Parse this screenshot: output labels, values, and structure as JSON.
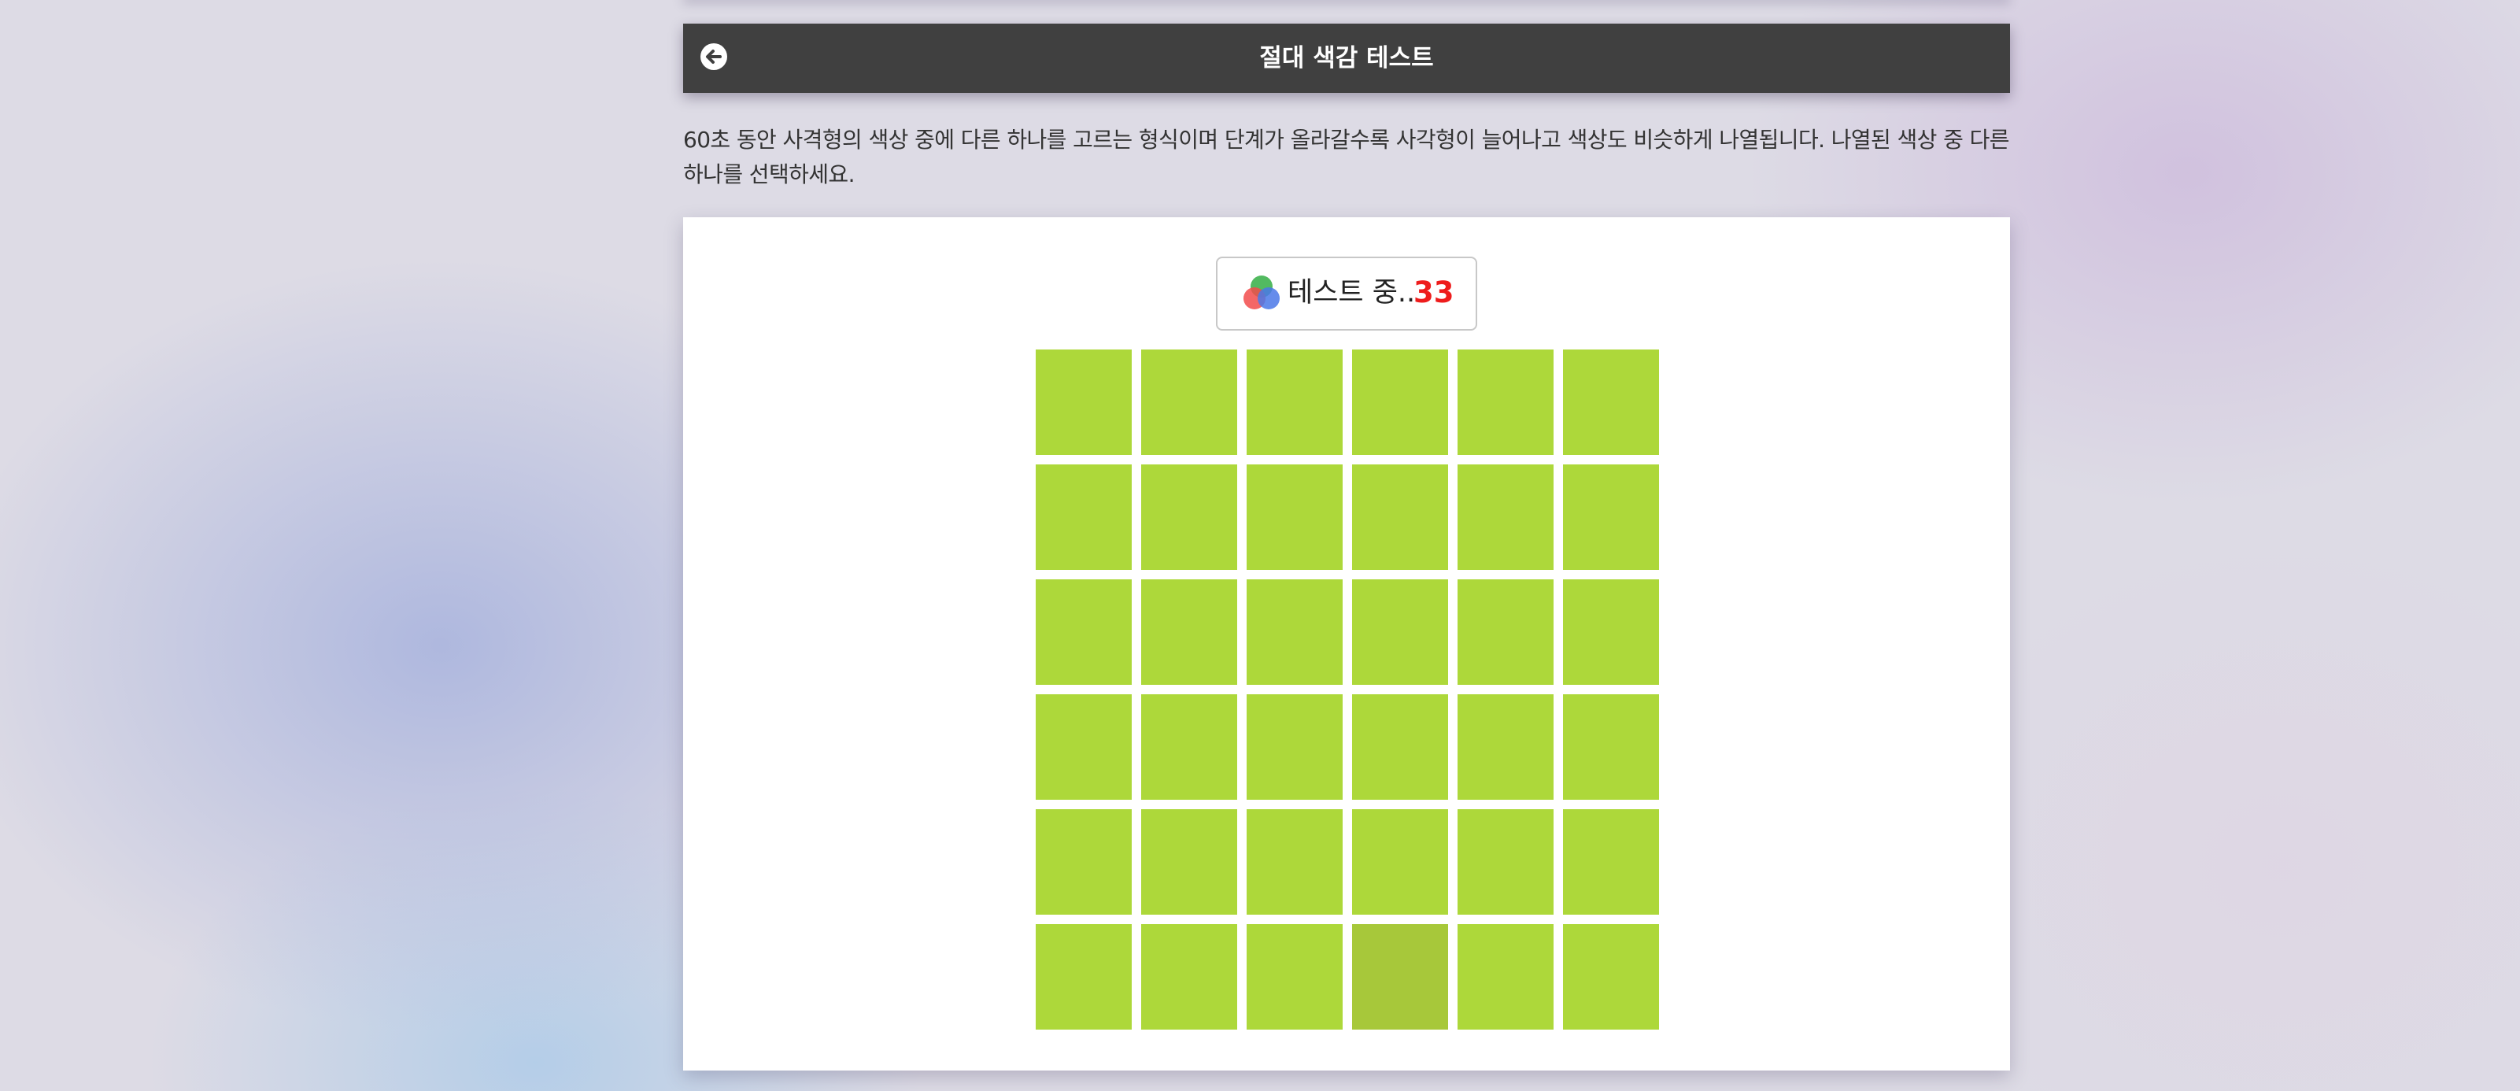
{
  "header": {
    "title": "절대 색감 테스트",
    "back_icon": "arrow-left-circle-icon"
  },
  "description": "60초 동안 사격형의 색상 중에 다른 하나를 고르는 형식이며 단계가 올라갈수록 사각형이 늘어나고 색상도 비슷하게 나열됩니다. 나열된 색상 중 다른 하나를 선택하세요.",
  "status": {
    "icon": "color-circles-icon",
    "label": "테스트 중..",
    "count": "33"
  },
  "grid": {
    "rows": 6,
    "cols": 6,
    "base_color": "#add83a",
    "odd_color": "#a7c83a",
    "odd_row": 6,
    "odd_col": 4
  },
  "colors": {
    "header_bg": "#404040",
    "count_red": "#ee1c1c",
    "card_bg": "#ffffff"
  }
}
